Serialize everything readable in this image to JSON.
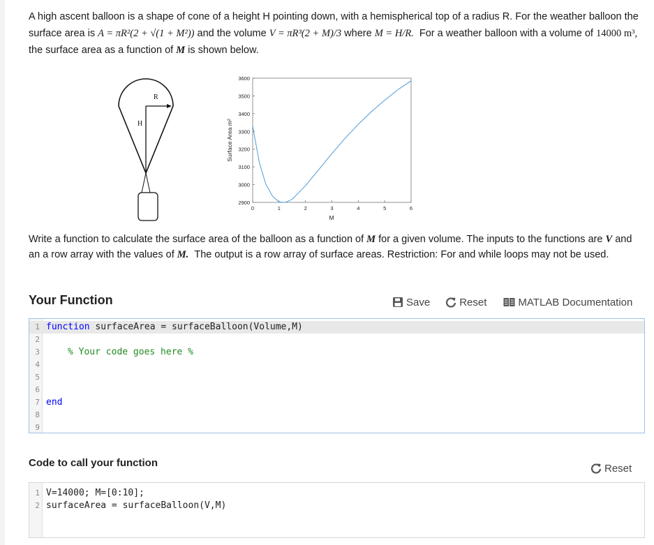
{
  "problem": {
    "p1_a": "A high ascent balloon is a shape of cone of a height H pointing down, with a hemispherical top of a radius R. For the weather balloon the surface area is",
    "area_formula": "A = πR²(2 + √(1 + M²))",
    "p1_b": "and the volume",
    "volume_formula": "V = πR³(2 + M)/3",
    "p1_c": "where",
    "m_def": "M = H/R.",
    "p1_d": "For a weather balloon with a volume of",
    "volume_value": "14000 m³,",
    "p1_e": "the surface area as a function of",
    "m_symbol": "M",
    "p1_f": "is shown below."
  },
  "figure": {
    "balloon_label_R": "R",
    "balloon_label_H": "H",
    "plot_ylabel": "Surface Area m²",
    "plot_xlabel": "M"
  },
  "chart_data": {
    "type": "line",
    "title": "",
    "xlabel": "M",
    "ylabel": "Surface Area m²",
    "xlim": [
      0,
      6
    ],
    "ylim": [
      2900,
      3600
    ],
    "xticks": [
      0,
      1,
      2,
      3,
      4,
      5,
      6
    ],
    "yticks": [
      2900,
      3000,
      3100,
      3200,
      3300,
      3400,
      3500,
      3600
    ],
    "grid": false,
    "series": [
      {
        "color": "#4d9ad6",
        "x": [
          0,
          0.25,
          0.5,
          0.75,
          1,
          1.25,
          1.5,
          2,
          2.5,
          3,
          3.5,
          4,
          4.5,
          5,
          5.5,
          6
        ],
        "y": [
          3330,
          3125,
          3002,
          2935,
          2902,
          2900,
          2918,
          2994,
          3084,
          3175,
          3261,
          3340,
          3412,
          3476,
          3535,
          3585
        ]
      }
    ]
  },
  "description": {
    "d_a": "Write a function to calculate the surface area of the balloon as a function of",
    "m1": "M",
    "d_b": "for a given volume.  The inputs to the functions are",
    "v1": "V",
    "d_c": "and an a row array with the values of",
    "m2": "M.",
    "d_d": "The output is a row array of surface areas.  Restriction: For and while loops may not be used."
  },
  "your_function": {
    "title": "Your Function",
    "save_label": "Save",
    "reset_label": "Reset",
    "doc_label": "MATLAB Documentation",
    "line_numbers": [
      "1",
      "2",
      "3",
      "4",
      "5",
      "6",
      "7",
      "8",
      "9"
    ],
    "code_line1_kw": "function",
    "code_line1_rest": " surfaceArea = surfaceBalloon(Volume,M)",
    "code_line3": "% Your code goes here %",
    "code_line7": "end"
  },
  "code_to_call": {
    "title": "Code to call your function",
    "reset_label": "Reset",
    "line_numbers": [
      "1",
      "2"
    ],
    "lines": [
      "V=14000; M=[0:10];",
      "surfaceArea = surfaceBalloon(V,M)"
    ]
  }
}
